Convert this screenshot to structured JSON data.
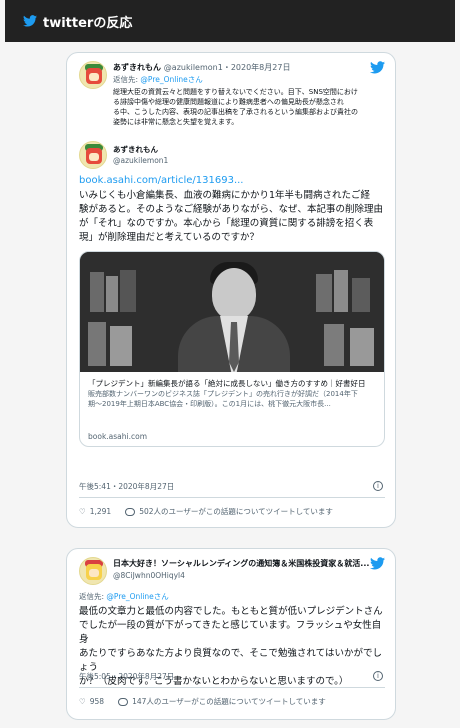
{
  "header": {
    "title": "twitterの反応",
    "icon": "twitter-bird-icon"
  },
  "colors": {
    "twitter_blue": "#1d9bf0",
    "header_bg": "#222222"
  },
  "tweet1": {
    "name": "あずきれもん",
    "handle_date": "@azukilemon1・2020年8月27日",
    "reply_prefix": "返信先:",
    "reply_to": "@Pre_Onlineさん",
    "quote_lines": [
      "総理大臣の資質云々と問題をすり替えないでください。目下、SNS空間におけ",
      "る誹謗中傷や総理の健康問題報道により難病患者への偏見助長が懸念され",
      "る中、こうした内容、表現の記事出稿を了承されるという編集部および貴社の",
      "姿勢には非常に懸念と失望を覚えます。"
    ],
    "quote_name": "あずきれもん",
    "quote_handle": "@azukilemon1",
    "link": "book.asahi.com/article/131693...",
    "body_lines": [
      "いみじくも小倉編集長、血液の難病にかかり1年半も闘病されたご経",
      "験があると。そのようなご経験がありながら、なぜ、本記事の削除理由",
      "が「それ」なのですか。本心から「総理の資質に関する誹謗を招く表",
      "現」が削除理由だと考えているのですか？"
    ],
    "card": {
      "title": "「プレジデント」新編集長が語る「絶対に成長しない」働き方のすすめ｜好書好日",
      "desc_lines": [
        "販売部数ナンバーワンのビジネス誌「プレジデント」の売れ行きが好調だ（2014年下",
        "期〜2019年上期日本ABC協会・印刷版）。この1月には、桃下徹元大阪市長..."
      ],
      "domain": "book.asahi.com"
    },
    "time": "午後5:41・2020年8月27日",
    "likes": "1,291",
    "conversation": "502人のユーザーがこの話題についてツイートしています"
  },
  "tweet2": {
    "name": "日本大好き！ソーシャルレンディングの通知簿＆米国株投資家＆就活...",
    "handle": "@8CiJwhn0OHiqyl4",
    "reply_prefix": "返信先:",
    "reply_to": "@Pre_Onlineさん",
    "body_lines": [
      "最低の文章力と最低の内容でした。もともと質が低いプレジデントさん",
      "でしたが一段の質が下がってきたと感じています。フラッシュや女性自身",
      "あたりですらあなた方より良質なので、そこで勉強されてはいかがでしょう",
      "か？（皮肉です。こう書かないとわからないと思いますので。）"
    ],
    "time": "午後5:05・2020年8月27日",
    "likes": "958",
    "conversation": "147人のユーザーがこの話題についてツイートしています"
  }
}
